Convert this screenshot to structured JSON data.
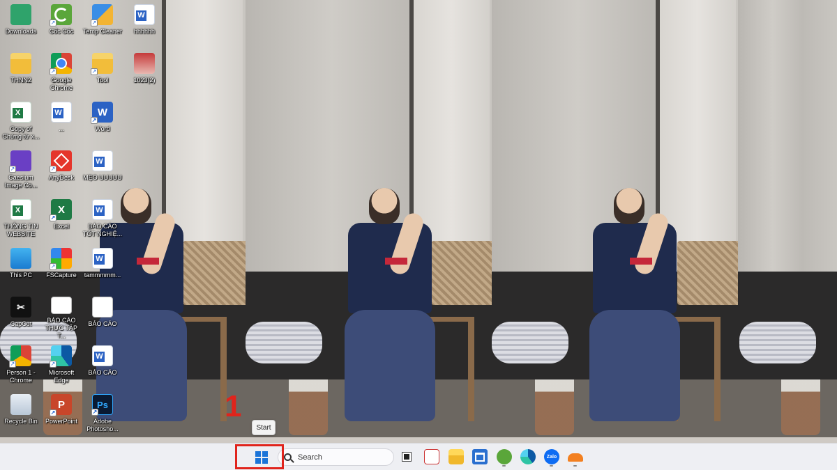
{
  "desktop": {
    "icons": [
      {
        "label": "Downloads",
        "icon": "downloads-folder-icon"
      },
      {
        "label": "Cốc Cốc",
        "icon": "coccoc-browser-icon"
      },
      {
        "label": "Temp Cleaner",
        "icon": "temp-cleaner-icon"
      },
      {
        "label": "hhhhhh",
        "icon": "word-document-icon"
      },
      {
        "label": "THNN2",
        "icon": "folder-icon"
      },
      {
        "label": "Google Chrome",
        "icon": "chrome-icon"
      },
      {
        "label": "Tool",
        "icon": "folder-icon"
      },
      {
        "label": "1023(2)",
        "icon": "image-file-icon"
      },
      {
        "label": "Copy of Chứng từ x...",
        "icon": "excel-document-icon"
      },
      {
        "label": "...",
        "icon": "word-document-icon"
      },
      {
        "label": "Word",
        "icon": "word-app-icon"
      },
      {
        "label": "Caesium Image Co...",
        "icon": "caesium-icon"
      },
      {
        "label": "AnyDesk",
        "icon": "anydesk-icon"
      },
      {
        "label": "MẸO UUUUU",
        "icon": "word-document-icon"
      },
      {
        "label": "THÔNG TIN WEBSITE",
        "icon": "excel-document-icon"
      },
      {
        "label": "Excel",
        "icon": "excel-app-icon"
      },
      {
        "label": "BÁO CÁO TỐT NGHIỆ...",
        "icon": "word-document-icon"
      },
      {
        "label": "This PC",
        "icon": "this-pc-icon"
      },
      {
        "label": "FSCapture",
        "icon": "fscapture-icon"
      },
      {
        "label": "tammmmm...",
        "icon": "word-document-icon"
      },
      {
        "label": "CapCut",
        "icon": "capcut-icon"
      },
      {
        "label": "BÁO CÁO THỰC TẬP T...",
        "icon": "document-icon"
      },
      {
        "label": "BÁO CÁO",
        "icon": "document-icon"
      },
      {
        "label": "Person 1 - Chrome",
        "icon": "chrome-profile-icon"
      },
      {
        "label": "Microsoft Edge",
        "icon": "edge-icon"
      },
      {
        "label": "BÁO CÁO",
        "icon": "word-document-icon"
      },
      {
        "label": "Recycle Bin",
        "icon": "recycle-bin-icon"
      },
      {
        "label": "PowerPoint",
        "icon": "powerpoint-icon"
      },
      {
        "label": "Adobe Photosho...",
        "icon": "photoshop-icon"
      }
    ]
  },
  "annotation": {
    "step_number": "1",
    "tooltip": "Start",
    "highlight_color": "#e0241c"
  },
  "taskbar": {
    "start_label": "Start",
    "search_placeholder": "Search",
    "zalo_label": "Zalo",
    "items": [
      {
        "name": "task-view-icon"
      },
      {
        "name": "snipping-tool-icon"
      },
      {
        "name": "file-explorer-icon"
      },
      {
        "name": "microsoft-store-icon"
      },
      {
        "name": "coccoc-icon"
      },
      {
        "name": "edge-icon"
      },
      {
        "name": "zalo-icon"
      },
      {
        "name": "cloud-app-icon"
      }
    ]
  },
  "colors": {
    "taskbar_bg": "#eeeff3",
    "windows_blue": "#1b74d8",
    "annotation_red": "#e0241c"
  }
}
